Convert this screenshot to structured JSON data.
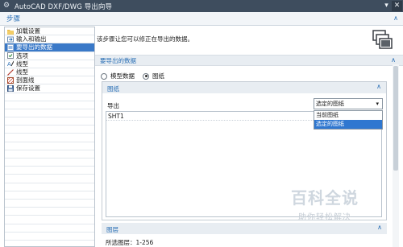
{
  "window": {
    "title": "AutoCAD DXF/DWG 导出向导",
    "menu_glyph": "▾",
    "close_glyph": "✕"
  },
  "steps_panel": {
    "header": "步骤",
    "collapse_glyph": "∧",
    "items": [
      {
        "label": "加载设置",
        "icon": "folder-open-icon",
        "active": false
      },
      {
        "label": "输入和输出",
        "icon": "input-output-icon",
        "active": false
      },
      {
        "label": "要导出的数据",
        "icon": "data-icon",
        "active": true
      },
      {
        "label": "选项",
        "icon": "options-icon",
        "active": false
      },
      {
        "label": "线型",
        "icon": "linetype-icon",
        "active": false
      },
      {
        "label": "线型",
        "icon": "line-icon",
        "active": false
      },
      {
        "label": "剖面线",
        "icon": "hatch-icon",
        "active": false
      },
      {
        "label": "保存设置",
        "icon": "save-icon",
        "active": false
      }
    ]
  },
  "content": {
    "description": "该步骤让您可以修正在导出的数据。",
    "header_icon": "drawing-sheets-icon",
    "section_title": "要导出的数据",
    "radio_model_data": "模型数据",
    "radio_drawing": "图纸",
    "selected_radio": "图纸",
    "drawing_panel": {
      "title": "图纸",
      "export_label": "导出",
      "select_value": "选定的图纸",
      "dropdown_options": [
        "当前图纸",
        "选定的图纸"
      ],
      "selected_option": "选定的图纸",
      "list_items": [
        "SHT1"
      ]
    },
    "layer_panel": {
      "title": "图层",
      "info": "所选图层：1-256"
    }
  },
  "watermark": {
    "main": "百科全说",
    "sub": "助你轻松解决"
  },
  "colors": {
    "titlebar": "#3e4d5e",
    "accent": "#2a6fb5",
    "selection": "#3a79c8"
  }
}
